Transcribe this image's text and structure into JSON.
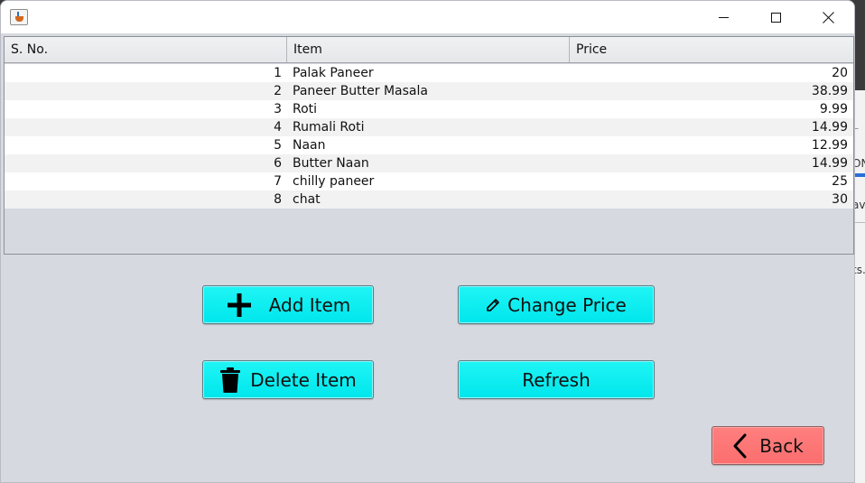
{
  "window": {
    "icon": "java-app-icon",
    "controls": {
      "minimize": "minimize-icon",
      "maximize": "maximize-icon",
      "close": "close-icon"
    }
  },
  "table": {
    "columns": [
      "S. No.",
      "Item",
      "Price"
    ],
    "rows": [
      {
        "sno": "1",
        "item": "Palak Paneer",
        "price": "20"
      },
      {
        "sno": "2",
        "item": "Paneer Butter Masala",
        "price": "38.99"
      },
      {
        "sno": "3",
        "item": "Roti",
        "price": "9.99"
      },
      {
        "sno": "4",
        "item": "Rumali Roti",
        "price": "14.99"
      },
      {
        "sno": "5",
        "item": "Naan",
        "price": "12.99"
      },
      {
        "sno": "6",
        "item": "Butter Naan",
        "price": "14.99"
      },
      {
        "sno": "7",
        "item": "chilly paneer",
        "price": "25"
      },
      {
        "sno": "8",
        "item": "chat",
        "price": "30"
      }
    ]
  },
  "buttons": {
    "add_item": "Add Item",
    "change_price": "Change Price",
    "delete_item": "Delete Item",
    "refresh": "Refresh",
    "back": "Back"
  },
  "background_window_fragments": [
    "L",
    "ON",
    "av",
    "ts."
  ],
  "colors": {
    "action_button": "#00e6ec",
    "back_button": "#fb6e6e",
    "window_bg": "#d6d9e0"
  }
}
